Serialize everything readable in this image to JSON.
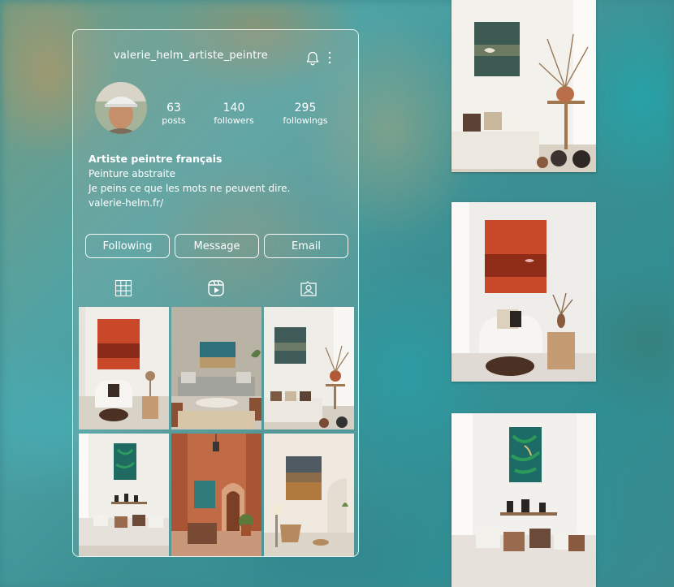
{
  "profile": {
    "username": "valerie_helm_artiste_peintre",
    "stats": [
      {
        "value": "63",
        "label": "posts"
      },
      {
        "value": "140",
        "label": "followers"
      },
      {
        "value": "295",
        "label": "followings"
      }
    ],
    "bio": {
      "name": "Artiste peintre français",
      "line1": "Peinture abstraite",
      "line2": "Je peins ce que les mots ne peuvent dire.",
      "link": "valerie-helm.fr/"
    },
    "buttons": {
      "following": "Following",
      "message": "Message",
      "email": "Email"
    },
    "icons": {
      "notifications": "bell-icon",
      "more": "more-vertical-icon",
      "grid_tab": "grid-icon",
      "reels_tab": "reels-icon",
      "tagged_tab": "tagged-icon"
    }
  },
  "posts": [
    {
      "painting": "#c9482a",
      "wall": "#f1eee9",
      "floor": "#d9d2c7"
    },
    {
      "painting": "#2e6f7a",
      "wall": "#b9b3a6",
      "floor": "#cfc7bb"
    },
    {
      "painting": "#405a58",
      "wall": "#efede8",
      "floor": "#d6cfc4"
    },
    {
      "painting": "#1f6b62",
      "wall": "#f0eee9",
      "floor": "#d7d0c6"
    },
    {
      "painting": "#2f7c7a",
      "wall": "#c06a46",
      "floor": "#c9977a"
    },
    {
      "painting": "#8a6b4a",
      "wall": "#efe9df",
      "floor": "#ddd5c8"
    }
  ],
  "showcase": [
    {
      "painting": "#3c5a52",
      "wall": "#f3f1ec"
    },
    {
      "painting": "#c84a2b",
      "wall": "#efedea"
    },
    {
      "painting": "#1c6b66",
      "wall": "#f2f0ec"
    }
  ],
  "colors": {
    "text": "#ffffff",
    "panel_border": "#ffffff",
    "background_teal": "#3a8a8e"
  }
}
